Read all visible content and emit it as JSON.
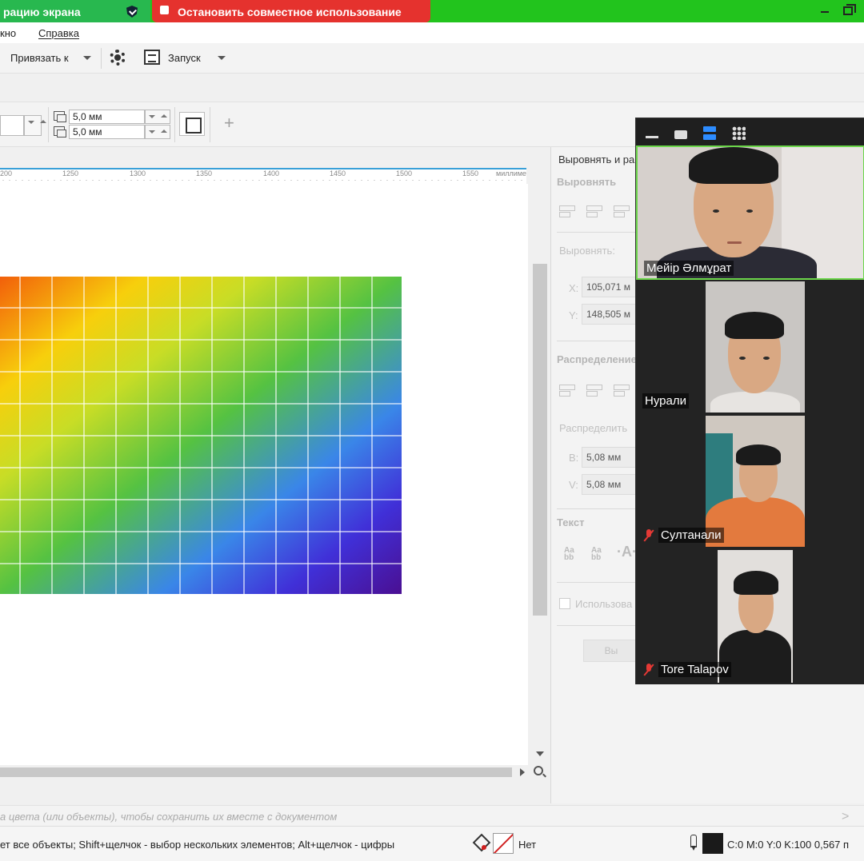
{
  "share_bar": {
    "sharing_text": "рацию экрана",
    "stop_label": "Остановить совместное использование",
    "colors": {
      "banner": "#22c41d",
      "stop": "#e5322e"
    }
  },
  "menu": {
    "items": [
      "кно",
      "Справка"
    ]
  },
  "toolbar": {
    "snap_label": "Привязать к",
    "launch_label": "Запуск"
  },
  "property_bar": {
    "dup_x": "5,0 мм",
    "dup_y": "5,0 мм"
  },
  "ruler": {
    "ticks": [
      "200",
      "1250",
      "1300",
      "1350",
      "1400",
      "1450",
      "1500",
      "1550"
    ],
    "unit": "миллиметры"
  },
  "docker": {
    "title": "Выровнять и ра",
    "align_section": "Выровнять",
    "align_to": "Выровнять:",
    "x_label": "X:",
    "x_value": "105,071 м",
    "y_label": "Y:",
    "y_value": "148,505 м",
    "distribute_section": "Распределение",
    "distribute_to": "Распределить",
    "b_label": "B:",
    "b_value": "5,08 мм",
    "v_label": "V:",
    "v_value": "5,08 мм",
    "text_section": "Текст",
    "use_label": "Использова",
    "btn_label": "Вы"
  },
  "participants": [
    {
      "name": "Мейір Әлмұрат",
      "muted": false,
      "active": true
    },
    {
      "name": "Нурали",
      "muted": false,
      "active": false
    },
    {
      "name": "Султанали",
      "muted": true,
      "active": false
    },
    {
      "name": "Tore Talapov",
      "muted": true,
      "active": false
    }
  ],
  "palette_hint": "а цвета (или объекты), чтобы сохранить их вместе с документом",
  "status": {
    "message": "ет все объекты; Shift+щелчок - выбор нескольких элементов; Alt+щелчок - цифры",
    "fill_label": "Нет",
    "outline": "C:0 M:0 Y:0 K:100  0,567 п"
  }
}
